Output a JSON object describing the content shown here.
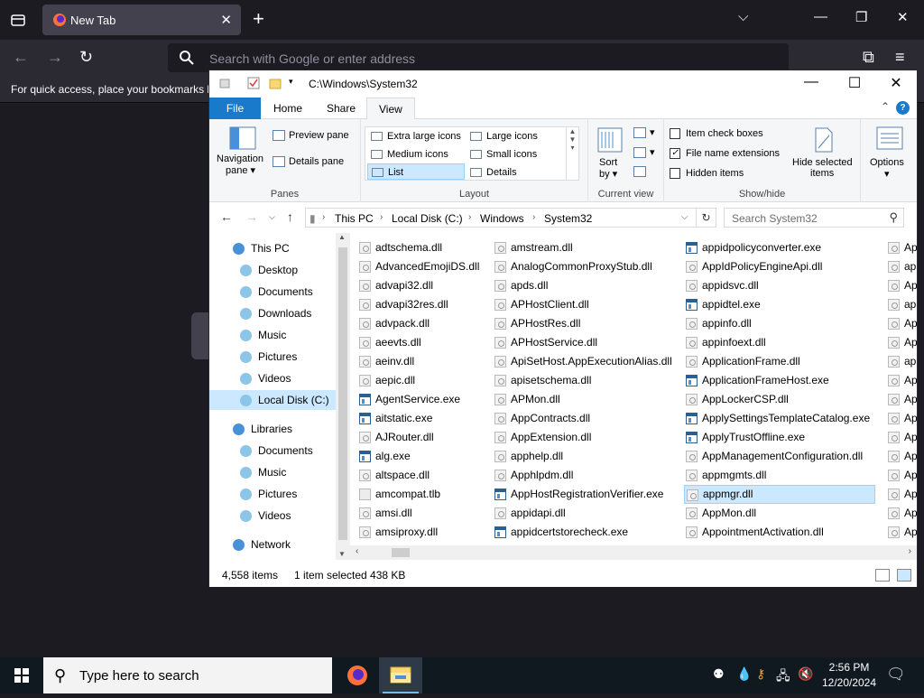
{
  "browser": {
    "tab_title": "New Tab",
    "url_placeholder": "Search with Google or enter address",
    "bookmarks_hint": "For quick access, place your bookmarks h"
  },
  "explorer": {
    "path_title": "C:\\Windows\\System32",
    "tabs": [
      "File",
      "Home",
      "Share",
      "View"
    ],
    "active_tab": "View",
    "ribbon": {
      "panes": {
        "navigation_pane": "Navigation",
        "navigation_pane_2": "pane",
        "preview_pane": "Preview pane",
        "details_pane": "Details pane",
        "group_label": "Panes"
      },
      "layout": {
        "items": [
          "Extra large icons",
          "Large icons",
          "Medium icons",
          "Small icons",
          "List",
          "Details"
        ],
        "selected": "List",
        "group_label": "Layout"
      },
      "current_view": {
        "sort_by": "Sort",
        "sort_by_2": "by",
        "group_label": "Current view"
      },
      "show_hide": {
        "item_check_boxes": "Item check boxes",
        "file_name_extensions": "File name extensions",
        "hidden_items": "Hidden items",
        "hide_selected": "Hide selected",
        "hide_selected_2": "items",
        "group_label": "Show/hide",
        "checked": [
          false,
          true,
          false
        ]
      },
      "options": "Options"
    },
    "breadcrumb": [
      "This PC",
      "Local Disk (C:)",
      "Windows",
      "System32"
    ],
    "search_placeholder": "Search System32",
    "nav_tree": [
      {
        "label": "This PC",
        "level": 1
      },
      {
        "label": "Desktop",
        "level": 2
      },
      {
        "label": "Documents",
        "level": 2
      },
      {
        "label": "Downloads",
        "level": 2
      },
      {
        "label": "Music",
        "level": 2
      },
      {
        "label": "Pictures",
        "level": 2
      },
      {
        "label": "Videos",
        "level": 2
      },
      {
        "label": "Local Disk (C:)",
        "level": 2,
        "selected": true
      },
      {
        "label": "Libraries",
        "level": 1
      },
      {
        "label": "Documents",
        "level": 2
      },
      {
        "label": "Music",
        "level": 2
      },
      {
        "label": "Pictures",
        "level": 2
      },
      {
        "label": "Videos",
        "level": 2
      },
      {
        "label": "Network",
        "level": 1
      }
    ],
    "files": {
      "col1": [
        "adtschema.dll",
        "AdvancedEmojiDS.dll",
        "advapi32.dll",
        "advapi32res.dll",
        "advpack.dll",
        "aeevts.dll",
        "aeinv.dll",
        "aepic.dll",
        "AgentService.exe",
        "aitstatic.exe",
        "AJRouter.dll",
        "alg.exe",
        "altspace.dll",
        "amcompat.tlb",
        "amsi.dll",
        "amsiproxy.dll"
      ],
      "col2": [
        "amstream.dll",
        "AnalogCommonProxyStub.dll",
        "apds.dll",
        "APHostClient.dll",
        "APHostRes.dll",
        "APHostService.dll",
        "ApiSetHost.AppExecutionAlias.dll",
        "apisetschema.dll",
        "APMon.dll",
        "AppContracts.dll",
        "AppExtension.dll",
        "apphelp.dll",
        "Apphlpdm.dll",
        "AppHostRegistrationVerifier.exe",
        "appidapi.dll",
        "appidcertstorecheck.exe"
      ],
      "col3": [
        "appidpolicyconverter.exe",
        "AppIdPolicyEngineApi.dll",
        "appidsvc.dll",
        "appidtel.exe",
        "appinfo.dll",
        "appinfoext.dll",
        "ApplicationFrame.dll",
        "ApplicationFrameHost.exe",
        "AppLockerCSP.dll",
        "ApplySettingsTemplateCatalog.exe",
        "ApplyTrustOffline.exe",
        "AppManagementConfiguration.dll",
        "appmgmts.dll",
        "appmgr.dll",
        "AppMon.dll",
        "AppointmentActivation.dll"
      ],
      "col4": [
        "Ap",
        "ap",
        "Ap",
        "ap",
        "Ap",
        "Ap",
        "ap",
        "Ap",
        "Ap",
        "Ap",
        "Ap",
        "Ap",
        "Ap",
        "Ap",
        "Ap",
        "Ap"
      ],
      "selected": "appmgr.dll"
    },
    "status": {
      "count": "4,558 items",
      "selection": "1 item selected  438 KB"
    }
  },
  "taskbar": {
    "search_placeholder": "Type here to search",
    "time": "2:56 PM",
    "date": "12/20/2024"
  },
  "colors": {
    "accent": "#1979ca",
    "selection": "#cce8ff",
    "taskbar": "#101820",
    "browser_bg": "#1c1b22"
  }
}
